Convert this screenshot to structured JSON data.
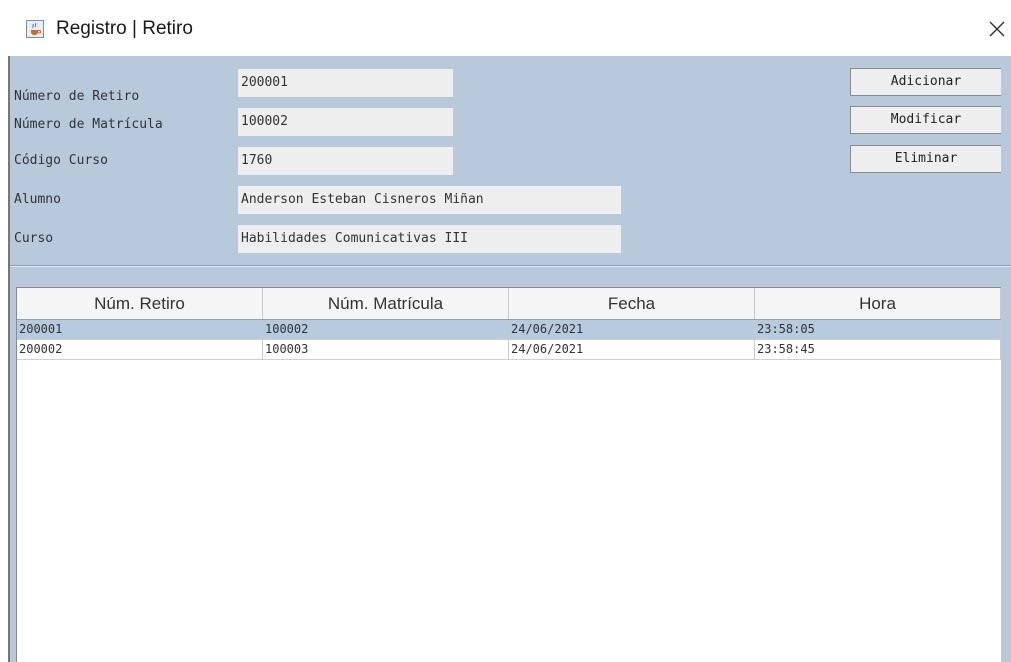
{
  "window": {
    "title": "Registro | Retiro",
    "app_icon": "java-cup-icon",
    "close_icon": "close-icon"
  },
  "form": {
    "numero_retiro": {
      "label": "Número de Retiro",
      "value": "200001"
    },
    "numero_matricula": {
      "label": "Número de Matrícula",
      "value": "100002"
    },
    "codigo_curso": {
      "label": "Código Curso",
      "value": "1760"
    },
    "alumno": {
      "label": "Alumno",
      "value": "Anderson Esteban Cisneros Miñan"
    },
    "curso": {
      "label": "Curso",
      "value": "Habilidades Comunicativas III"
    }
  },
  "buttons": {
    "adicionar": "Adicionar",
    "modificar": "Modificar",
    "eliminar": "Eliminar"
  },
  "table": {
    "columns": [
      "Núm. Retiro",
      "Núm. Matrícula",
      "Fecha",
      "Hora"
    ],
    "rows": [
      [
        "200001",
        "100002",
        "24/06/2021",
        "23:58:05"
      ],
      [
        "200002",
        "100003",
        "24/06/2021",
        "23:58:45"
      ]
    ],
    "selected_row": 0
  },
  "colors": {
    "panel": "#b9c9dc",
    "selection": "#b7cbe0",
    "field": "#eeeeee"
  }
}
